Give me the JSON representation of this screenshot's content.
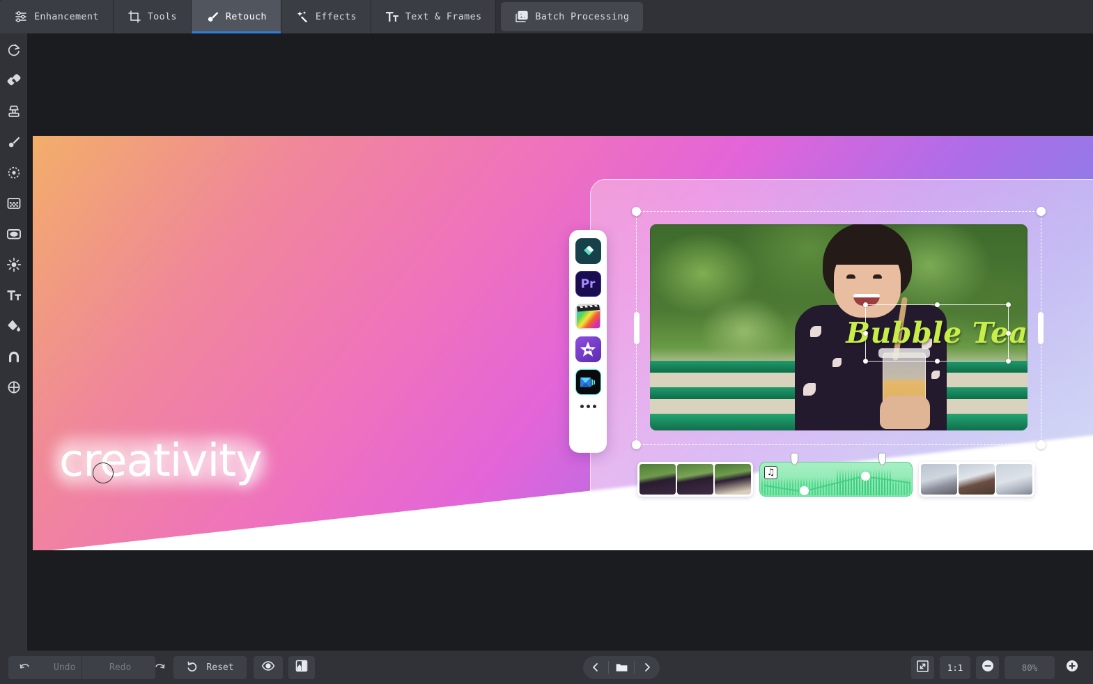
{
  "app": {
    "active_tab": "Retouch",
    "accent_color": "#2c7fe0",
    "canvas_background": "#1b1c1f",
    "chrome_color": "#303238"
  },
  "topbar": {
    "tabs": [
      {
        "label": "Enhancement",
        "icon": "sliders-icon",
        "active": false
      },
      {
        "label": "Tools",
        "icon": "crop-icon",
        "active": false
      },
      {
        "label": "Retouch",
        "icon": "brush-icon",
        "active": true
      },
      {
        "label": "Effects",
        "icon": "magic-wand-icon",
        "active": false
      },
      {
        "label": "Text & Frames",
        "icon": "text-format-icon",
        "active": false
      },
      {
        "label": "Batch Processing",
        "icon": "images-stack-icon",
        "active": false
      }
    ]
  },
  "toolrail": {
    "tools": [
      {
        "name": "rotate-icon",
        "title": "Rotate"
      },
      {
        "name": "healing-patch-icon",
        "title": "Patch"
      },
      {
        "name": "clone-stamp-icon",
        "title": "Clone Stamp"
      },
      {
        "name": "brush-icon",
        "title": "Brush"
      },
      {
        "name": "blemish-remover-icon",
        "title": "Blemish Remover"
      },
      {
        "name": "mosaic-icon",
        "title": "Mosaic"
      },
      {
        "name": "vignette-icon",
        "title": "Vignette"
      },
      {
        "name": "brightness-icon",
        "title": "Brightness"
      },
      {
        "name": "text-icon",
        "title": "Text"
      },
      {
        "name": "paint-bucket-icon",
        "title": "Paint Bucket"
      },
      {
        "name": "magnet-icon",
        "title": "Magnet"
      },
      {
        "name": "target-icon",
        "title": "Target"
      }
    ]
  },
  "canvas": {
    "artwork_title": "creativity",
    "text_layer": {
      "content": "Bubble Tea",
      "color": "#c8ee4a",
      "selected": true
    },
    "dock": {
      "apps": [
        {
          "name": "filmora-app-icon",
          "label": "Filmora"
        },
        {
          "name": "premiere-pro-app-icon",
          "label": "Pr"
        },
        {
          "name": "final-cut-pro-app-icon",
          "label": "Final Cut Pro"
        },
        {
          "name": "imovie-app-icon",
          "label": "iMovie"
        },
        {
          "name": "video-editor-app-icon",
          "label": "Video Editor"
        }
      ],
      "more_label": "•••"
    },
    "timeline": {
      "clips": [
        {
          "name": "video-clip",
          "thumbs": 3
        },
        {
          "name": "audio-clip",
          "icon": "music-note-icon",
          "keyframes": 2,
          "markers": 2
        },
        {
          "name": "video-clip",
          "thumbs": 3
        }
      ]
    }
  },
  "bottombar": {
    "undo_label": "Undo",
    "redo_label": "Redo",
    "reset_label": "Reset",
    "preview_icon": "eye-icon",
    "compare_icon": "split-compare-icon",
    "prev_icon": "chevron-left-icon",
    "folder_icon": "folder-icon",
    "next_icon": "chevron-right-icon",
    "fit_icon": "fit-screen-icon",
    "actual_size_label": "1:1",
    "zoom_out_icon": "minus-circle-icon",
    "zoom_level": "80%",
    "zoom_in_icon": "plus-circle-icon"
  }
}
